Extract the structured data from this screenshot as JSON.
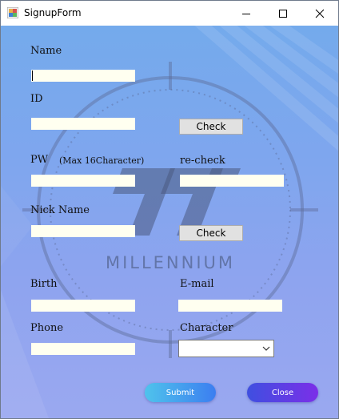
{
  "window": {
    "title": "SignupForm",
    "controls": {
      "minimize": "minimize-icon",
      "maximize": "maximize-icon",
      "close": "close-icon"
    }
  },
  "background": {
    "logo_text": "MILLENNIUM"
  },
  "form": {
    "name_label": "Name",
    "name_value": "",
    "id_label": "ID",
    "id_value": "",
    "id_check_label": "Check",
    "pw_label": "PW",
    "pw_hint": "(Max 16Character)",
    "pw_value": "",
    "recheck_label": "re-check",
    "recheck_value": "",
    "nickname_label": "Nick Name",
    "nickname_value": "",
    "nickname_check_label": "Check",
    "birth_label": "Birth",
    "birth_value": "",
    "email_label": "E-mail",
    "email_value": "",
    "phone_label": "Phone",
    "phone_value": "",
    "character_label": "Character",
    "character_selected": "",
    "submit_label": "Submit",
    "close_label": "Close"
  },
  "colors": {
    "textbox_bg": "#fffff0",
    "submit_gradient": [
      "#4fc3ec",
      "#3c7ef0"
    ],
    "close_gradient": [
      "#3f4fe0",
      "#7b2fe8"
    ]
  }
}
